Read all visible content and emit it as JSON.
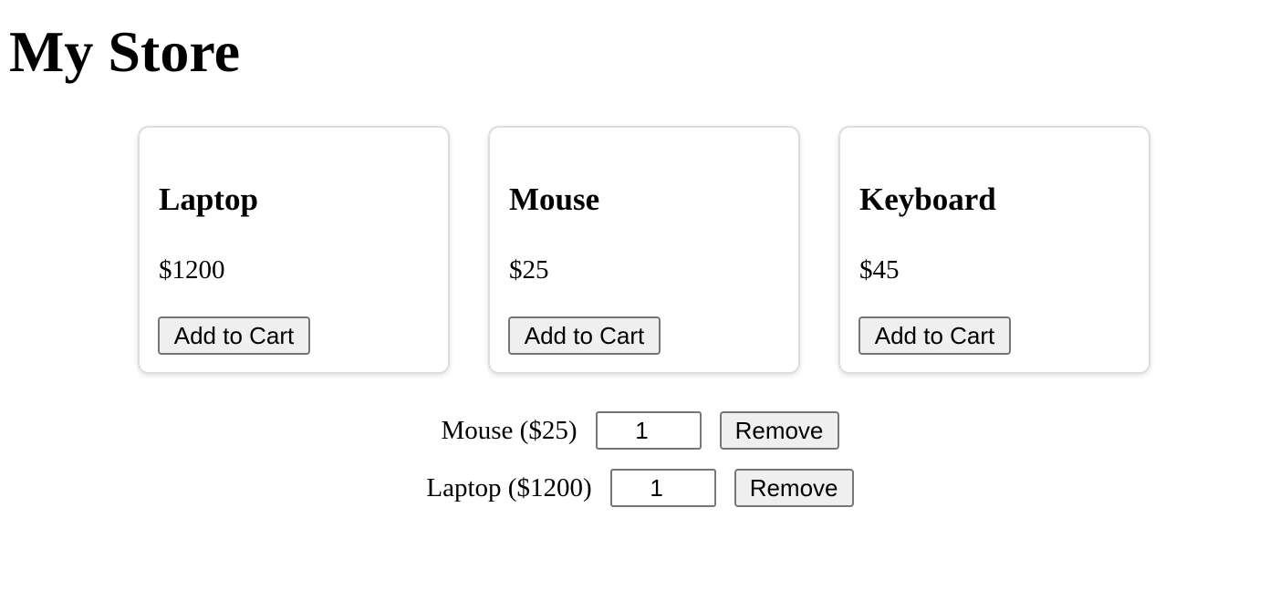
{
  "header": {
    "title": "My Store"
  },
  "products": [
    {
      "name": "Laptop",
      "price": "$1200",
      "button_label": "Add to Cart"
    },
    {
      "name": "Mouse",
      "price": "$25",
      "button_label": "Add to Cart"
    },
    {
      "name": "Keyboard",
      "price": "$45",
      "button_label": "Add to Cart"
    }
  ],
  "cart": {
    "items": [
      {
        "label": "Mouse ($25)",
        "quantity": "1",
        "remove_label": "Remove"
      },
      {
        "label": "Laptop ($1200)",
        "quantity": "1",
        "remove_label": "Remove"
      }
    ]
  },
  "colors": {
    "card_border": "#dddddd",
    "button_bg": "#efefef",
    "button_border": "#767676"
  }
}
